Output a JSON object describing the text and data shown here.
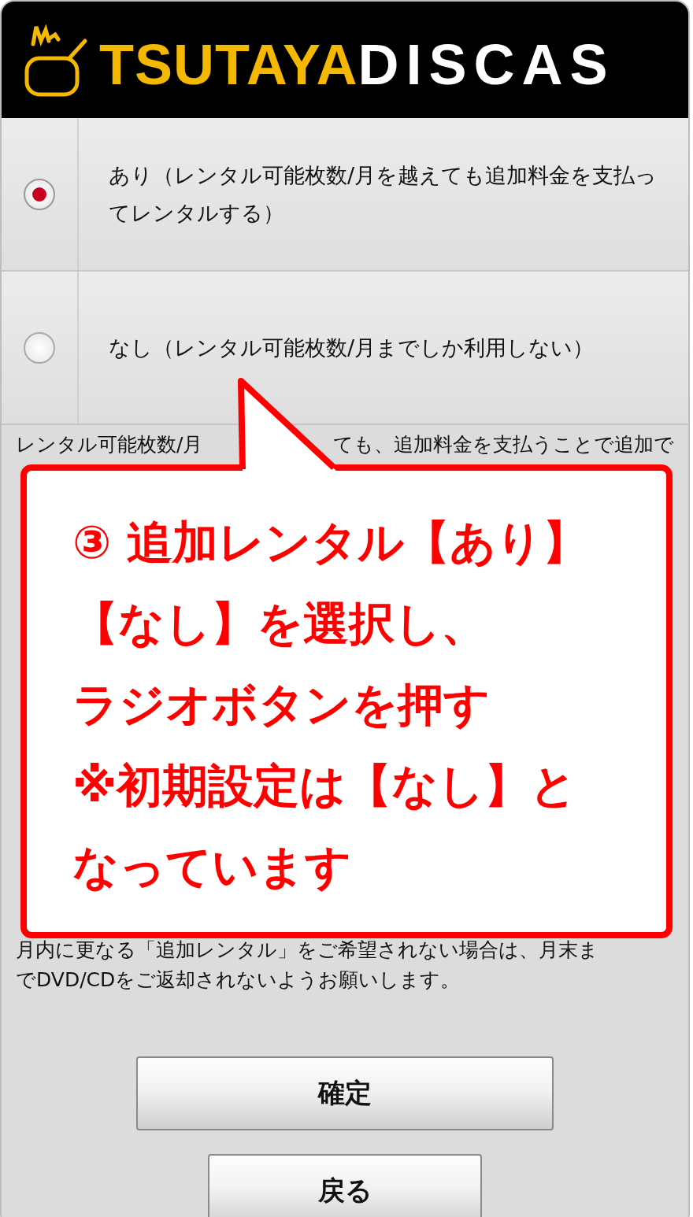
{
  "header": {
    "logo_primary": "TSUTAYA",
    "logo_secondary": "DISCAS"
  },
  "options": [
    {
      "label": "あり（レンタル可能枚数/月を越えても追加料金を支払ってレンタルする）",
      "selected": true
    },
    {
      "label": "なし（レンタル可能枚数/月までしか利用しない）",
      "selected": false
    }
  ],
  "notice": {
    "line_1_left": "レンタル可能枚数/月",
    "line_1_right": "ても、追加料金を支払うことで追加で",
    "closing_lines": [
      "月内に更なる「追加レンタル」をご希望されない場合は、月末ま",
      "でDVD/CDをご返却されないようお願いします。"
    ]
  },
  "callout": {
    "lines": [
      "③ 追加レンタル【あり】",
      "【なし】を選択し、",
      "ラジオボタンを押す",
      "※初期設定は【なし】と",
      "なっています"
    ]
  },
  "buttons": [
    {
      "label": "確定",
      "kind": "primary"
    },
    {
      "label": "戻る",
      "kind": "secondary"
    }
  ]
}
